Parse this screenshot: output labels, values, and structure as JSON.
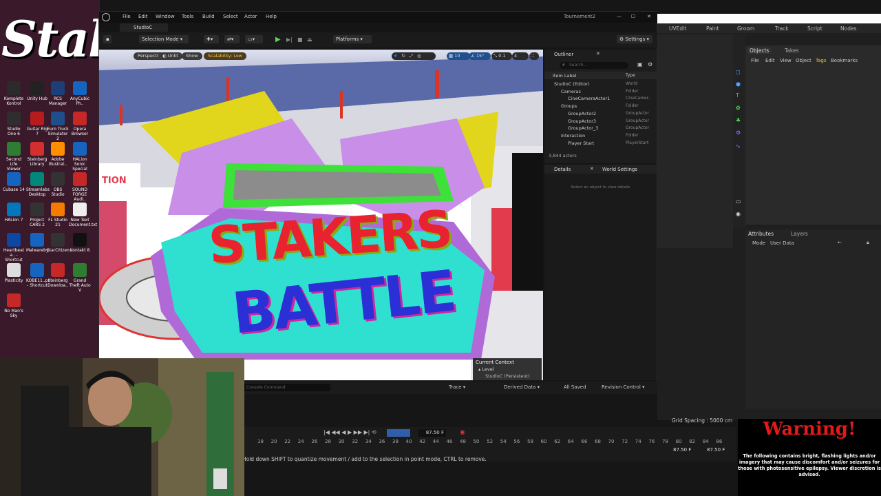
{
  "desktop": {
    "icons": [
      {
        "label": "Komplete Kontrol",
        "color": "#2b2b2b"
      },
      {
        "label": "Unity Hub",
        "color": "#222"
      },
      {
        "label": "RCS Manager",
        "color": "#1c3f7a"
      },
      {
        "label": "AnyCubic Ph..",
        "color": "#1565c0"
      },
      {
        "label": "Studio One 6",
        "color": "#2e2e2e"
      },
      {
        "label": "Guitar Rig 7",
        "color": "#b71c1c"
      },
      {
        "label": "Euro Truck Simulator 2",
        "color": "#1f4e8c"
      },
      {
        "label": "Opera Browser",
        "color": "#c62828"
      },
      {
        "label": "Second Life Viewer",
        "color": "#2e7d32"
      },
      {
        "label": "Steinberg Library",
        "color": "#d32f2f"
      },
      {
        "label": "Adobe Illustrat..",
        "color": "#ff8f00"
      },
      {
        "label": "HALion Sonic Special",
        "color": "#1565c0"
      },
      {
        "label": "Cubase 14",
        "color": "#1565c0"
      },
      {
        "label": "Streamlabs Desktop",
        "color": "#00897b"
      },
      {
        "label": "OBS Studio",
        "color": "#333"
      },
      {
        "label": "SOUND FORGE Audi..",
        "color": "#c62828"
      },
      {
        "label": "HALion 7",
        "color": "#0277bd"
      },
      {
        "label": "Project CARS 2",
        "color": "#333"
      },
      {
        "label": "FL Studio 21",
        "color": "#f57c00"
      },
      {
        "label": "New Text Document.txt",
        "color": "#eee"
      },
      {
        "label": "Heartbeat a.. - Shortcut",
        "color": "#0d47a1"
      },
      {
        "label": "Malwareby..",
        "color": "#1565c0"
      },
      {
        "label": "StarCitizen..",
        "color": "#333"
      },
      {
        "label": "Kontakt 8",
        "color": "#111"
      },
      {
        "label": "Plasticity",
        "color": "#ddd"
      },
      {
        "label": "KOBE11..pr.. - Shortcut",
        "color": "#1565c0"
      },
      {
        "label": "Steinberg Downloa..",
        "color": "#c62828"
      },
      {
        "label": "Grand Theft Auto V",
        "color": "#2e7d32"
      },
      {
        "label": "No Man's Sky",
        "color": "#c62828"
      }
    ],
    "logo_text": "Stake"
  },
  "ue": {
    "window_title": "Tournement2",
    "menu": [
      "File",
      "Edit",
      "Window",
      "Tools",
      "Build",
      "Select",
      "Actor",
      "Help"
    ],
    "level_tab": "StudioC",
    "toolbar": {
      "mode": "Selection Mode",
      "platforms": "Platforms",
      "settings": "Settings"
    },
    "viewport": {
      "hud_perspective": "Perspective",
      "hud_lit": "Unlit",
      "hud_show": "Show",
      "hud_scalability": "Scalability: Low",
      "grid_snap": "10",
      "rot_snap": "15°",
      "scale_snap": "0.1",
      "cam_speed": "4",
      "sign_line1": "STAKERS",
      "sign_line2": "BATTLE",
      "side_banner": "TION",
      "context_title": "Current Context",
      "context_level": "Level",
      "context_value": "StudioC (Persistent)"
    },
    "outliner": {
      "title": "Outliner",
      "search_placeholder": "Search...",
      "col_label": "Item Label",
      "col_type": "Type",
      "items": [
        {
          "label": "StudioC (Editor)",
          "type": "World"
        },
        {
          "label": "Cameras",
          "type": "Folder"
        },
        {
          "label": "CineCameraActor1",
          "type": "CineCamer.."
        },
        {
          "label": "Groups",
          "type": "Folder"
        },
        {
          "label": "GroupActor2",
          "type": "GroupActor"
        },
        {
          "label": "GroupActor3",
          "type": "GroupActor"
        },
        {
          "label": "GroupActor_3",
          "type": "GroupActor"
        },
        {
          "label": "Interaction",
          "type": "Folder"
        },
        {
          "label": "Player Start",
          "type": "PlayerStart"
        }
      ],
      "actor_count": "3,844 actors"
    },
    "details": {
      "tab_details": "Details",
      "tab_world": "World Settings",
      "empty_text": "Select an object to view details"
    },
    "status": {
      "console_placeholder": "Console Command",
      "trace": "Trace",
      "derived": "Derived Data",
      "saved": "All Saved",
      "revision": "Revision Control"
    }
  },
  "right_app": {
    "tabs": [
      "UVEdit",
      "Paint",
      "Groom",
      "Track",
      "Script",
      "Nodes"
    ],
    "objects_tab": "Objects",
    "takes_tab": "Takes",
    "obj_menu": [
      "File",
      "Edit",
      "View",
      "Object",
      "Tags",
      "Bookmarks"
    ],
    "attr_tab": "Attributes",
    "layers_tab": "Layers",
    "attr_menu": [
      "Mode",
      "User Data"
    ],
    "grid_spacing": "Grid Spacing : 5000 cm"
  },
  "timeline": {
    "frame_field": "87.50 F",
    "ticks": [
      "18",
      "20",
      "22",
      "24",
      "26",
      "28",
      "30",
      "32",
      "34",
      "36",
      "38",
      "40",
      "42",
      "44",
      "46",
      "48",
      "50",
      "52",
      "54",
      "56",
      "58",
      "60",
      "62",
      "64",
      "66",
      "68",
      "70",
      "72",
      "74",
      "76",
      "78",
      "80",
      "82",
      "84",
      "86"
    ],
    "end_left": "87.50 F",
    "end_right": "87.50 F",
    "hint": "Hold down SHIFT to quantize movement / add to the selection in point mode, CTRL to remove."
  },
  "warning": {
    "title": "Warning!",
    "body": "The following contains bright, flashing lights and/or imagery that may cause discomfort and/or seizures for those with photosensitive epilepsy. Viewer discretion is advised."
  },
  "colors": {
    "accent": "#0a84ff",
    "warning_red": "#e5191c",
    "sign_red": "#e8232f",
    "sign_blue": "#2a2fd6",
    "sign_teal": "#2fe0d0",
    "sign_green": "#3ee03a"
  }
}
